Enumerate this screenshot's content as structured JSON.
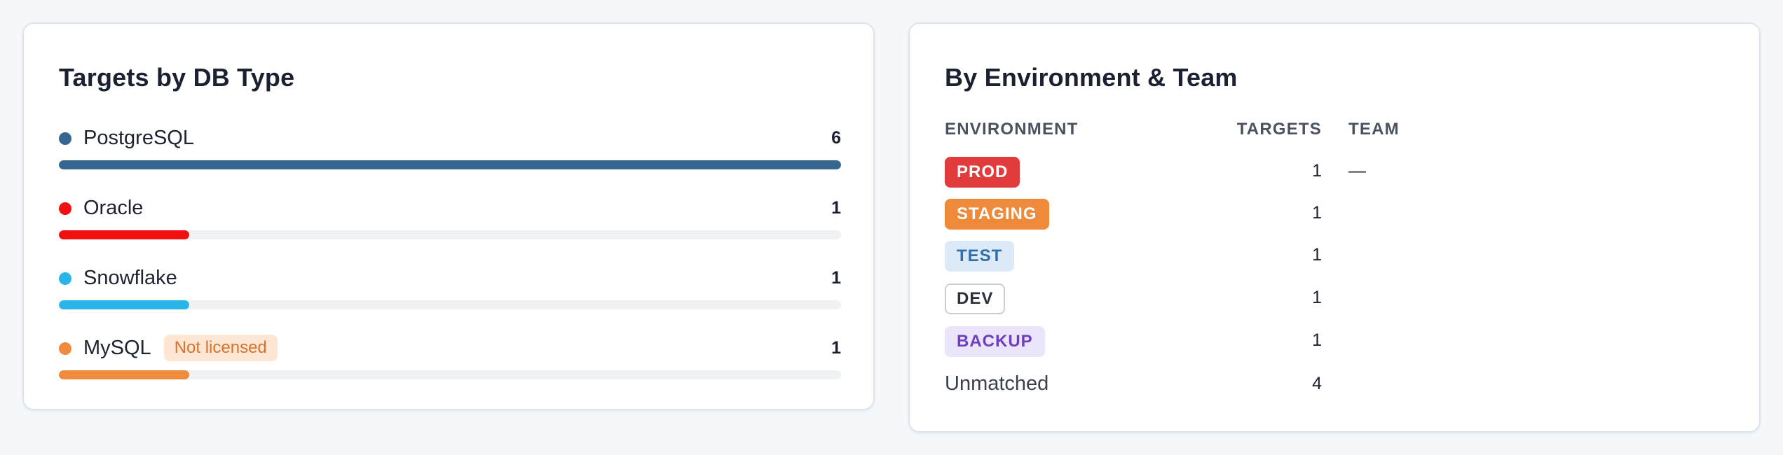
{
  "db_card": {
    "title": "Targets by DB Type",
    "max_count": 6,
    "items": [
      {
        "label": "PostgreSQL",
        "count": "6",
        "value": 6,
        "color": "#356690",
        "badge": ""
      },
      {
        "label": "Oracle",
        "count": "1",
        "value": 1,
        "color": "#f20f0f",
        "badge": ""
      },
      {
        "label": "Snowflake",
        "count": "1",
        "value": 1,
        "color": "#29b5e8",
        "badge": ""
      },
      {
        "label": "MySQL",
        "count": "1",
        "value": 1,
        "color": "#f08a3c",
        "badge": "Not licensed"
      }
    ]
  },
  "env_card": {
    "title": "By Environment & Team",
    "headers": {
      "environment": "ENVIRONMENT",
      "targets": "TARGETS",
      "team": "TEAM"
    },
    "rows": [
      {
        "env": "PROD",
        "targets": "1",
        "team": "—",
        "bg": "#e23b3b",
        "fg": "#ffffff",
        "border": "#e23b3b"
      },
      {
        "env": "STAGING",
        "targets": "1",
        "team": "",
        "bg": "#ef8a3a",
        "fg": "#ffffff",
        "border": "#ef8a3a"
      },
      {
        "env": "TEST",
        "targets": "1",
        "team": "",
        "bg": "#dce9f7",
        "fg": "#2f6ea9",
        "border": "#dce9f7"
      },
      {
        "env": "DEV",
        "targets": "1",
        "team": "",
        "bg": "#ffffff",
        "fg": "#2a303c",
        "border": "#c9ced6"
      },
      {
        "env": "BACKUP",
        "targets": "1",
        "team": "",
        "bg": "#ece4f8",
        "fg": "#6b3fc0",
        "border": "#ece4f8"
      }
    ],
    "unmatched": {
      "label": "Unmatched",
      "targets": "4"
    }
  }
}
